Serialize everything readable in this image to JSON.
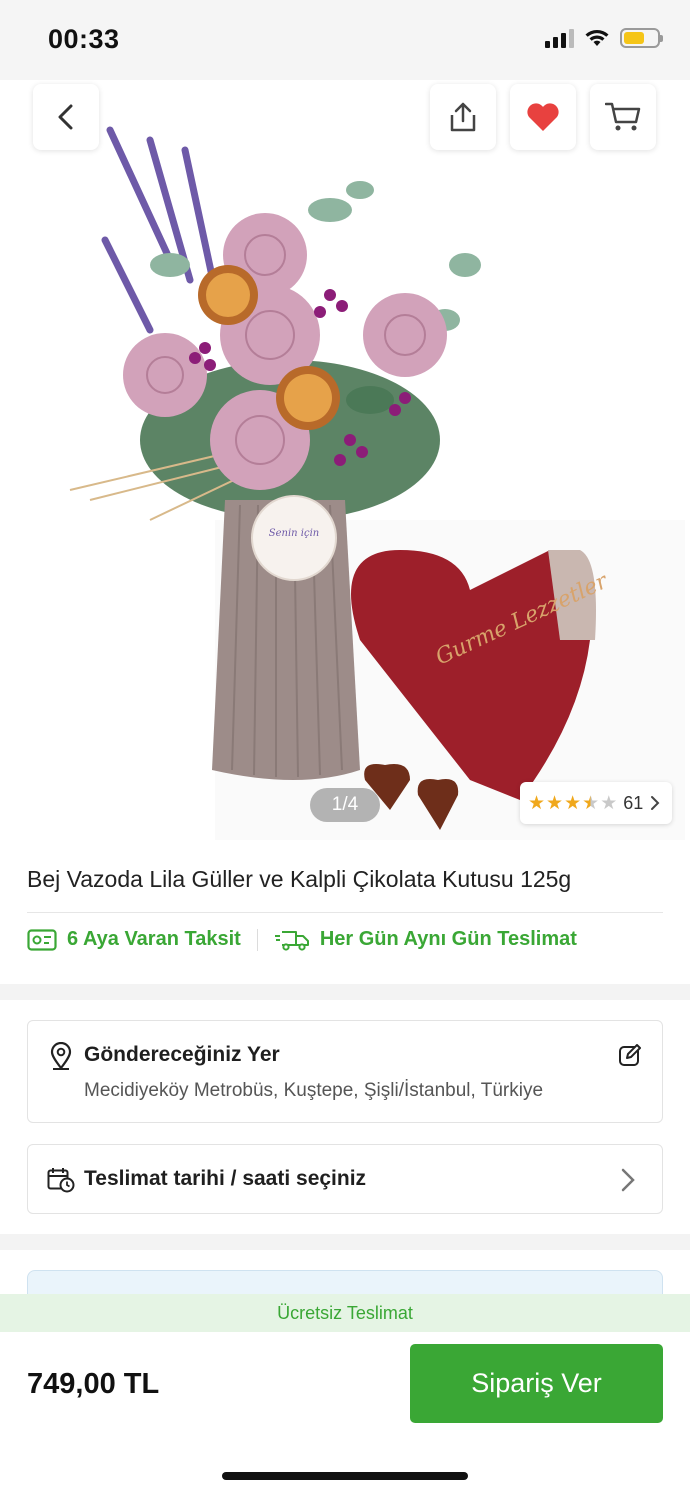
{
  "status_bar": {
    "time": "00:33",
    "icons": [
      "signal-icon",
      "wifi-icon",
      "battery-icon"
    ],
    "battery_color": "#f5c518"
  },
  "header": {
    "back_icon": "chevron-left-icon",
    "share_icon": "share-icon",
    "favorite_icon": "heart-icon",
    "cart_icon": "cart-icon",
    "favorite_color": "#e8413f"
  },
  "gallery": {
    "pager": "1/4",
    "rating_count": "61",
    "rating_stars": 3.5,
    "rating_star_color": "#f0a81c",
    "product_image_text": "Gurme Lezzetler",
    "tag_text": "Senin için"
  },
  "product": {
    "title": "Bej Vazoda Lila Güller ve Kalpli Çikolata Kutusu 125g"
  },
  "perks": [
    {
      "icon": "installment-icon",
      "label": "6 Aya Varan Taksit"
    },
    {
      "icon": "delivery-truck-icon",
      "label": "Her Gün Aynı Gün Teslimat"
    }
  ],
  "address_card": {
    "icon": "location-pin-icon",
    "title": "Göndereceğiniz Yer",
    "address": "Mecidiyeköy Metrobüs, Kuştepe, Şişli/İstanbul, Türkiye",
    "edit_icon": "edit-icon"
  },
  "delivery_card": {
    "icon": "calendar-clock-icon",
    "label": "Teslimat tarihi / saati seçiniz",
    "chevron_icon": "chevron-right-icon"
  },
  "footer": {
    "free_shipping": "Ücretsiz Teslimat",
    "price": "749,00 TL",
    "order_button": "Sipariş Ver"
  },
  "colors": {
    "accent_green": "#3aa735",
    "free_ship_bg": "#e5f4e4"
  }
}
